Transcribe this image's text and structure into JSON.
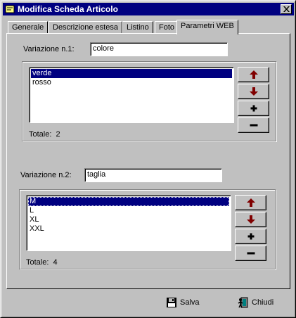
{
  "window": {
    "title": "Modifica Scheda Articolo"
  },
  "tabs": [
    {
      "label": "Generale"
    },
    {
      "label": "Descrizione estesa"
    },
    {
      "label": "Listino"
    },
    {
      "label": "Foto"
    },
    {
      "label": "Parametri WEB"
    }
  ],
  "active_tab": "Parametri WEB",
  "variation1": {
    "label": "Variazione n.1:",
    "value": "colore",
    "items": [
      "verde",
      "rosso"
    ],
    "selected": "verde",
    "total_label": "Totale:",
    "total": "2"
  },
  "variation2": {
    "label": "Variazione n.2:",
    "value": "taglia",
    "items": [
      "M",
      "L",
      "XL",
      "XXL"
    ],
    "selected": "M",
    "total_label": "Totale:",
    "total": "4"
  },
  "footer": {
    "save_label": "Salva",
    "close_label": "Chiudi"
  },
  "icons": {
    "up": "arrow-up-icon",
    "down": "arrow-down-icon",
    "add": "plus-icon",
    "remove": "minus-icon"
  },
  "colors": {
    "titlebar": "#000080",
    "selection": "#000080",
    "arrow": "#800000"
  }
}
